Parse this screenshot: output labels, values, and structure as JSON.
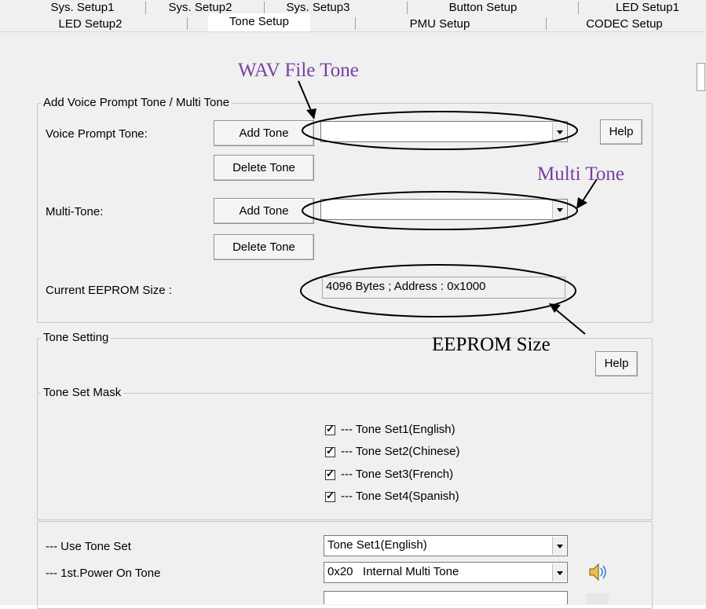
{
  "tabs_row1": [
    "Sys. Setup1",
    "Sys. Setup2",
    "Sys. Setup3",
    "Button Setup",
    "LED Setup1"
  ],
  "tabs_row2": [
    "LED Setup2",
    "Tone Setup",
    "PMU Setup",
    "CODEC Setup"
  ],
  "active_tab": "Tone Setup",
  "voice_group": {
    "title": "Add Voice Prompt Tone /  Multi Tone",
    "voice_prompt_label": "Voice Prompt Tone:",
    "multi_tone_label": "Multi-Tone:",
    "eeprom_label": "Current EEPROM Size :",
    "add_tone": "Add Tone",
    "delete_tone": "Delete Tone",
    "help": "Help",
    "voice_prompt_value": "",
    "multi_tone_value": "",
    "eeprom_value": "4096 Bytes ; Address : 0x1000"
  },
  "tone_setting": {
    "title": "Tone Setting",
    "help": "Help",
    "mask_title": "Tone Set Mask",
    "tone_sets": [
      {
        "label": "--- Tone Set1(English)",
        "checked": true
      },
      {
        "label": "--- Tone Set2(Chinese)",
        "checked": true
      },
      {
        "label": "--- Tone Set3(French)",
        "checked": true
      },
      {
        "label": "--- Tone Set4(Spanish)",
        "checked": true
      }
    ]
  },
  "tone_usage": {
    "use_tone_set_label": "--- Use Tone Set",
    "use_tone_set_value": "Tone Set1(English)",
    "power_on_label": "--- 1st.Power On Tone",
    "power_on_value": "0x20   Internal Multi Tone"
  },
  "annotations": {
    "wav_file_tone": "WAV File Tone",
    "multi_tone": "Multi Tone",
    "eeprom_size": "EEPROM Size"
  },
  "icons": {
    "speaker": "speaker-icon"
  }
}
